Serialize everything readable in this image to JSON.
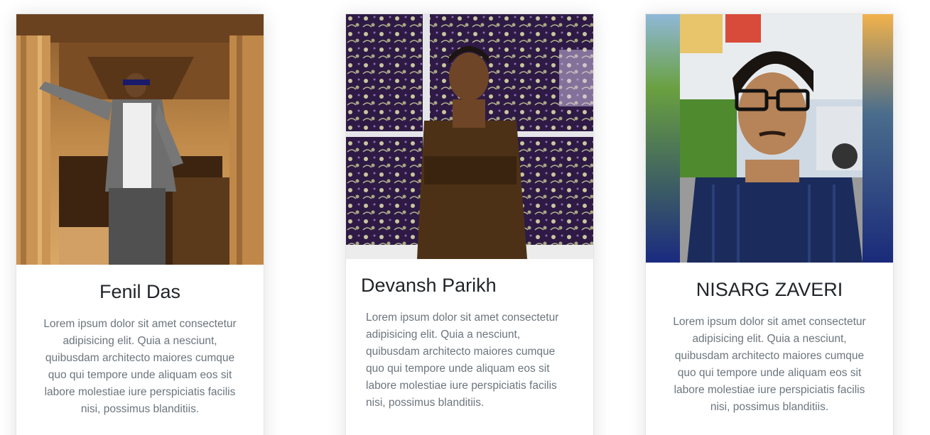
{
  "team": {
    "members": [
      {
        "name": "Fenil Das",
        "bio": "Lorem ipsum dolor sit amet consectetur adipisicing elit. Quia a nesciunt, quibusdam architecto maiores cumque quo qui tempore unde aliquam eos sit labore molestiae iure perspiciatis facilis nisi, possimus blanditiis."
      },
      {
        "name": "Devansh Parikh",
        "bio": "Lorem ipsum dolor sit amet consectetur adipisicing elit. Quia a nesciunt, quibusdam architecto maiores cumque quo qui tempore unde aliquam eos sit labore molestiae iure perspiciatis facilis nisi, possimus blanditiis."
      },
      {
        "name": "NISARG ZAVERI",
        "bio": "Lorem ipsum dolor sit amet consectetur adipisicing elit. Quia a nesciunt, quibusdam architecto maiores cumque quo qui tempore unde aliquam eos sit labore molestiae iure perspiciatis facilis nisi, possimus blanditiis."
      }
    ]
  },
  "colors": {
    "title": "#212529",
    "body_text": "#6c757d",
    "card_border": "#e6e6e6"
  }
}
